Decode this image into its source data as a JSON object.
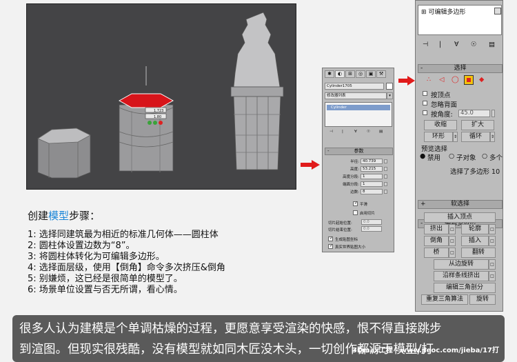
{
  "small_panel": {
    "object_name": "Cylinder1705",
    "modifier_list": "修改器列表",
    "stack_item": "Cylinder",
    "params_header": "参数",
    "params": [
      {
        "label": "半径:",
        "value": "40.739"
      },
      {
        "label": "高度:",
        "value": "53.215"
      },
      {
        "label": "高度分段:",
        "value": "1"
      },
      {
        "label": "端面分段:",
        "value": "1"
      },
      {
        "label": "边数:",
        "value": "8"
      }
    ],
    "smooth": "平滑",
    "slice_on": "启用切片",
    "slice_from": "切片起始位置:",
    "slice_from_value": "0.0",
    "slice_to": "切片结束位置:",
    "slice_to_value": "0.0",
    "gen_map": "生成贴图坐标",
    "real_world": "真实世界贴图大小"
  },
  "right_panel": {
    "stack_title": "可编辑多边形",
    "select_header": "选择",
    "by_vertex": "按顶点",
    "ignore_back": "忽略背面",
    "by_angle": "按角度:",
    "angle_value": "45.0",
    "shrink": "收缩",
    "grow": "扩大",
    "ring": "环形",
    "loop": "循环",
    "preview": "预览选择",
    "preview_opts": [
      "禁用",
      "子对象",
      "多个"
    ],
    "selected_info": "选择了多边形 10",
    "soft_header": "软选择",
    "edit_header": "编辑多边形",
    "buttons": {
      "insert_vertex": "插入顶点",
      "extrude": "挤出",
      "outline": "轮廓",
      "bevel": "倒角",
      "inset": "插入",
      "bridge": "桥",
      "flip": "翻转",
      "hinge": "从边旋转",
      "spline": "沿样条线挤出",
      "edit_tri": "编辑三角剖分",
      "retri": "重复三角算法",
      "turn": "旋转"
    }
  },
  "viewport": {
    "caddy_value_1": "1.723",
    "caddy_value_2": "1.80"
  },
  "steps": {
    "title_pre": "创建",
    "title_hl": "模型",
    "title_post": "步骤：",
    "lines": [
      "1: 选择同建筑最为相近的标准几何体——圆柱体",
      "2: 圆柱体设置边数为“8”。",
      "3: 将圆柱体转化为可编辑多边形。",
      "4: 选择面层级，使用【倒角】命令多次挤压&倒角",
      "5: 别嫌烦，这已经是很简单的模型了。",
      "6: 场景单位设置与否无所谓，看心情。"
    ]
  },
  "bottom": {
    "line1": "很多人认为建模是个单调枯燥的过程，更愿意享受渲染的快感，恨不得直接跳步",
    "line2": "到渲图。但现实很残酷，没有模型就如同木匠没木头，一切创作都源于模型/打",
    "watermark": "3Dmax工程 - www.jieoc.com/jieba/17打"
  },
  "colors": {
    "accent_red": "#e11b1b",
    "selected_yellow": "#f4c20d",
    "highlight_blue": "#1a86d8"
  }
}
